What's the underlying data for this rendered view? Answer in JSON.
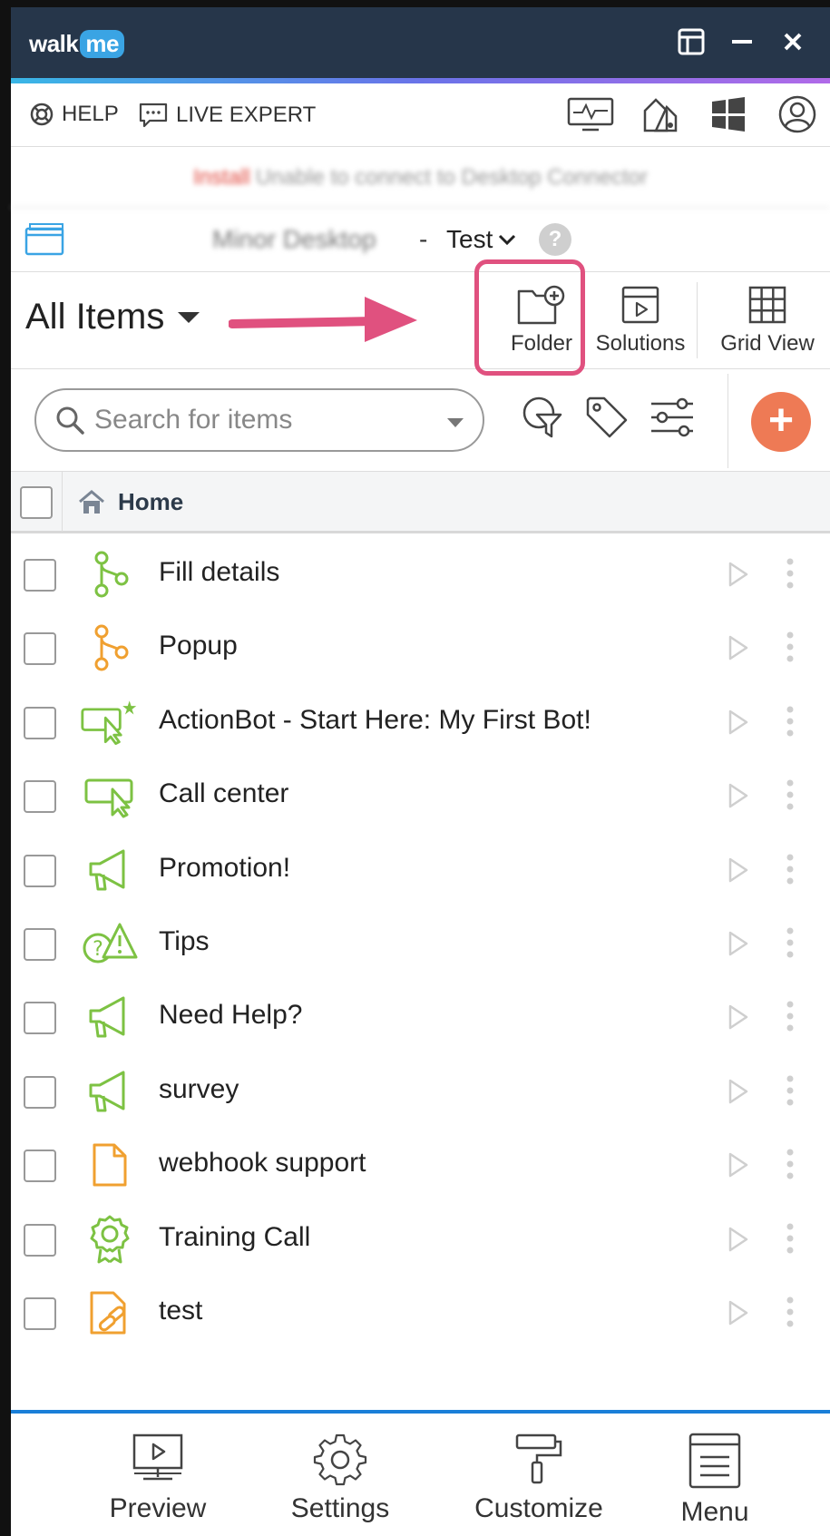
{
  "window": {
    "logo_left": "walk",
    "logo_right": "me"
  },
  "helpbar": {
    "help_label": "HELP",
    "live_expert_label": "LIVE EXPERT"
  },
  "connector": {
    "install_label": "Install",
    "message": "Unable to connect to Desktop Connector"
  },
  "environment": {
    "system_name": "Minor Desktop",
    "separator": "-",
    "env_label": "Test",
    "help_label": "?"
  },
  "toolbar": {
    "title": "All Items",
    "folder_label": "Folder",
    "solutions_label": "Solutions",
    "grid_view_label": "Grid View"
  },
  "search": {
    "placeholder": "Search for items",
    "add_label": "+"
  },
  "breadcrumb": {
    "home_label": "Home"
  },
  "items": [
    {
      "name": "Fill details",
      "icon": "smart-walkthru-icon",
      "color": "#7dc243"
    },
    {
      "name": "Popup",
      "icon": "smart-walkthru-icon",
      "color": "#f0a030"
    },
    {
      "name": "ActionBot - Start Here: My First Bot!",
      "icon": "actionbot-icon",
      "color": "#7dc243"
    },
    {
      "name": "Call center",
      "icon": "launcher-icon",
      "color": "#7dc243"
    },
    {
      "name": "Promotion!",
      "icon": "megaphone-icon",
      "color": "#7dc243"
    },
    {
      "name": "Tips",
      "icon": "tips-icon",
      "color": "#7dc243"
    },
    {
      "name": "Need Help?",
      "icon": "megaphone-icon",
      "color": "#7dc243"
    },
    {
      "name": "survey",
      "icon": "megaphone-icon",
      "color": "#7dc243"
    },
    {
      "name": "webhook support",
      "icon": "article-icon",
      "color": "#f0a030"
    },
    {
      "name": "Training Call",
      "icon": "badge-icon",
      "color": "#7dc243"
    },
    {
      "name": "test",
      "icon": "link-icon",
      "color": "#f0a030"
    }
  ],
  "bottomnav": {
    "preview_label": "Preview",
    "settings_label": "Settings",
    "customize_label": "Customize",
    "menu_label": "Menu"
  },
  "colors": {
    "titlebar": "#26364a",
    "accent_pink": "#e0517f",
    "add_button": "#ee7a55",
    "bottom_border": "#1a7fd8",
    "green_icon": "#7dc243",
    "orange_icon": "#f0a030"
  }
}
